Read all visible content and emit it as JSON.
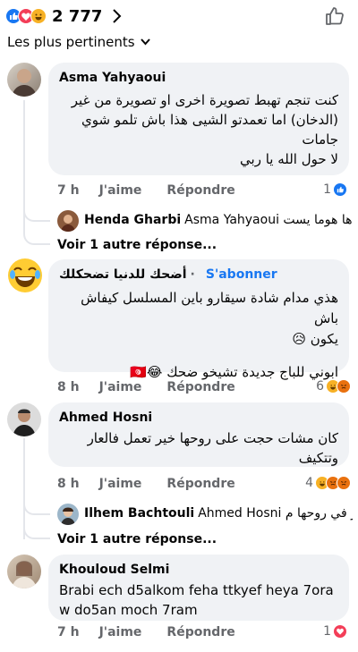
{
  "header": {
    "reaction_total": "2 777",
    "sort_label": "Les plus pertinents"
  },
  "actions": {
    "like": "J'aime",
    "reply": "Répondre"
  },
  "comments": [
    {
      "author": "Asma Yahyaoui",
      "lines": [
        "كنت تنجم تهبط تصويرة اخرى او تصويرة من غير",
        "(الدخان) اما تعمدتو الشيى هذا باش تلمو شوي",
        "جامات",
        "لا حول الله يا ربي"
      ],
      "time": "7 h",
      "reactions": "1",
      "reply": {
        "name": "Henda Gharbi",
        "text": "Asma Yahyaoui معناها هوما يست..."
      },
      "more": "Voir 1 autre réponse..."
    },
    {
      "author": "أضحك للدنيا تضحكلك",
      "subscribe": "S'abonner",
      "lines": [
        "هذي مدام شادة سيقارو باين المسلسل كيفاش باش",
        "يكون 😥",
        "",
        "ابوني للباج جديدة تشيخو ضحك 😂🇹🇳"
      ],
      "time": "8 h",
      "reactions": "6"
    },
    {
      "author": "Ahmed Hosni",
      "lines": [
        "كان مشات حجت على روحها خير تعمل فالعار",
        "وتتكيف"
      ],
      "time": "8 h",
      "reactions": "4",
      "reply": {
        "name": "Ilhem Bachtouli",
        "text": "Ahmed Hosni تضر في روحها م..."
      },
      "more": "Voir 1 autre réponse..."
    },
    {
      "author": "Khouloud Selmi",
      "lines": [
        "Brabi ech d5alkom feha ttkyef heya 7ora",
        "w do5an moch 7ram"
      ],
      "time": "7 h",
      "reactions": "1"
    }
  ],
  "colors": {
    "like_blue": "#1877f2",
    "love_red": "#f33e58",
    "haha_yellow": "#f7b125",
    "meta_gray": "#65676b",
    "bubble_bg": "#f0f2f5"
  }
}
